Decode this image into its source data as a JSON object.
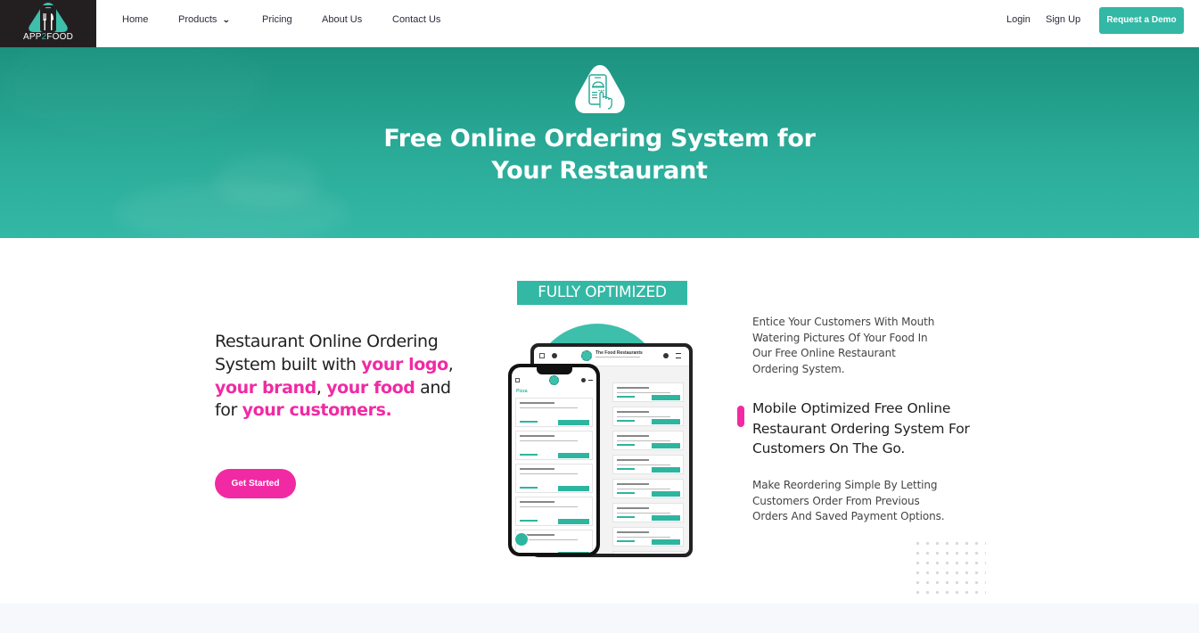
{
  "brand": {
    "name_prefix": "APP",
    "name_accent": "2",
    "name_suffix": "FOOD",
    "accent_color": "#33b8a5",
    "pink_color": "#f12aa3",
    "logo_bg": "#231f20"
  },
  "nav": {
    "items": [
      {
        "label": "Home"
      },
      {
        "label": "Products",
        "has_dropdown": true
      },
      {
        "label": "Pricing"
      },
      {
        "label": "About Us"
      },
      {
        "label": "Contact Us"
      }
    ],
    "login_label": "Login",
    "signup_label": "Sign Up",
    "demo_label": "Request a Demo"
  },
  "hero": {
    "icon": "phone-order-tap-icon",
    "title_line1": "Free Online Ordering System for",
    "title_line2": "Your Restaurant"
  },
  "main": {
    "lead_parts": [
      {
        "text": "Restaurant Online Ordering System built with ",
        "highlight": false
      },
      {
        "text": "your logo",
        "highlight": true
      },
      {
        "text": ", ",
        "highlight": false
      },
      {
        "text": "your brand",
        "highlight": true
      },
      {
        "text": ", ",
        "highlight": false
      },
      {
        "text": "your food",
        "highlight": true
      },
      {
        "text": " and for ",
        "highlight": false
      },
      {
        "text": "your customers.",
        "highlight": true
      }
    ],
    "cta_label": "Get Started",
    "badge": "FULLY OPTIMIZED",
    "devices": {
      "tablet_restaurant_name": "The Food Restaurants",
      "phone_category": "Pizza"
    },
    "features": [
      {
        "text": "Entice Your Customers With Mouth Watering Pictures Of Your Food In Our Free Online Restaurant Ordering System.",
        "active": false
      },
      {
        "text": "Mobile Optimized Free Online Restaurant Ordering System For Customers On The Go.",
        "active": true
      },
      {
        "text": "Make Reordering Simple By Letting Customers Order From Previous Orders And Saved Payment Options.",
        "active": false
      }
    ]
  }
}
